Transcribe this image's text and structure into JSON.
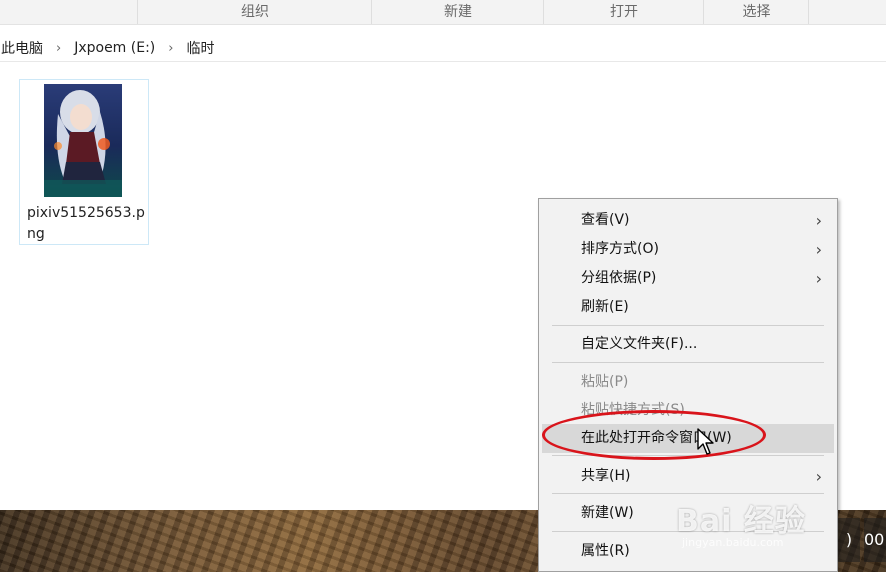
{
  "ribbon": {
    "groups": [
      "组织",
      "新建",
      "打开",
      "选择"
    ]
  },
  "address": {
    "crumbs": [
      "此电脑",
      "Jxpoem (E:)",
      "临时"
    ]
  },
  "file": {
    "name": "pixiv51525653.png"
  },
  "context_menu": {
    "items": [
      {
        "label": "查看(V)",
        "submenu": true
      },
      {
        "label": "排序方式(O)",
        "submenu": true
      },
      {
        "label": "分组依据(P)",
        "submenu": true
      },
      {
        "label": "刷新(E)",
        "submenu": false
      },
      {
        "label": "自定义文件夹(F)...",
        "submenu": false
      },
      {
        "label": "粘贴(P)",
        "disabled": true
      },
      {
        "label": "粘贴快捷方式(S)",
        "disabled": true
      },
      {
        "label": "在此处打开命令窗口(W)",
        "highlighted": true
      },
      {
        "label": "共享(H)",
        "submenu": true
      },
      {
        "label": "新建(W)",
        "submenu": false
      },
      {
        "label": "属性(R)",
        "submenu": false
      }
    ]
  },
  "taskbar": {
    "right_labels": [
      ")",
      "00"
    ]
  },
  "watermark": {
    "main": "Bai 经验",
    "sub": "jingyan.baidu.com"
  },
  "colors": {
    "annotation": "#d9141b",
    "menu_bg": "#f2f2f2",
    "selection_border": "#cde8f7"
  }
}
